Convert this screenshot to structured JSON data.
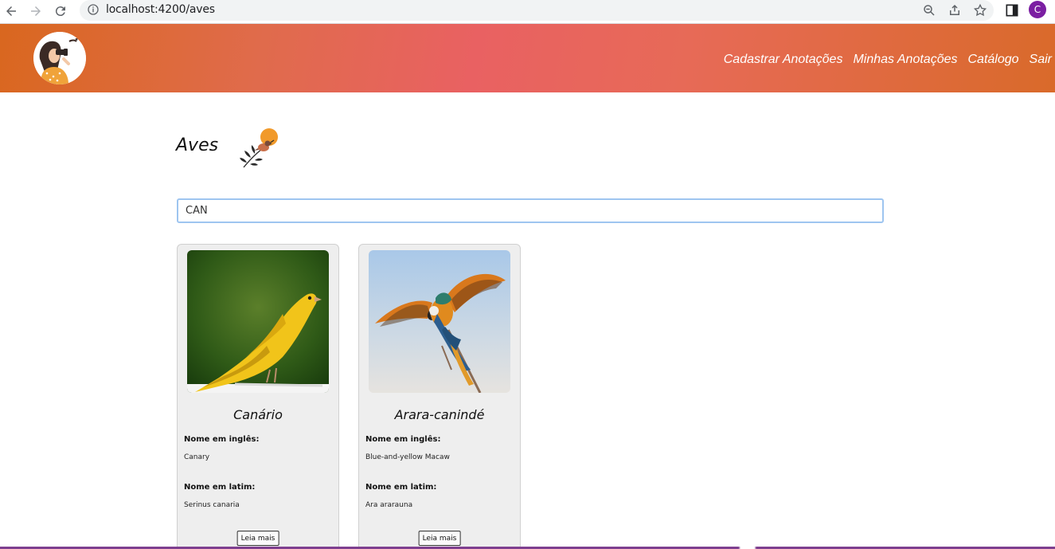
{
  "browser": {
    "url": "localhost:4200/aves",
    "profile_initial": "C"
  },
  "header": {
    "nav": [
      {
        "label": "Cadastrar Anotações"
      },
      {
        "label": "Minhas Anotações"
      },
      {
        "label": "Catálogo"
      },
      {
        "label": "Sair"
      }
    ]
  },
  "page": {
    "title": "Aves",
    "search_value": "CAN"
  },
  "cards": [
    {
      "name": "Canário",
      "english_label": "Nome em inglês:",
      "english_name": "Canary",
      "latin_label": "Nome em latim:",
      "latin_name": "Serinus canaria",
      "button": "Leia mais"
    },
    {
      "name": "Arara-canindé",
      "english_label": "Nome em inglês:",
      "english_name": "Blue-and-yellow Macaw",
      "latin_label": "Nome em latim:",
      "latin_name": "Ara ararauna",
      "button": "Leia mais"
    }
  ],
  "colors": {
    "header_start": "#d9671f",
    "header_mid": "#e96162",
    "accent_profile": "#7b1fa2"
  }
}
